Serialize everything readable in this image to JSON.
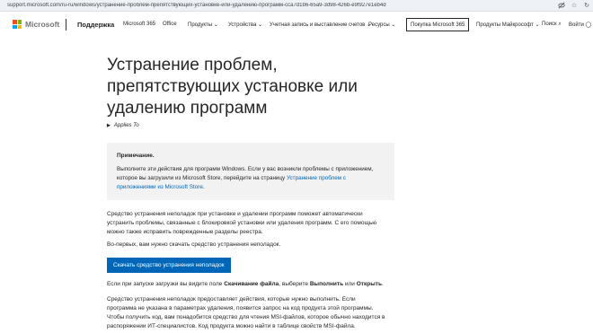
{
  "browser": {
    "url": "support.microsoft.com/ru-ru/windows/устранение-проблем-препятствующих-установке-или-удалению-программ-cca7d1b6-65a9-3d98-426b-e9f927e1eb4d"
  },
  "header": {
    "brand": "Microsoft",
    "section": "Поддержка",
    "nav": [
      "Microsoft 365",
      "Office",
      "Продукты",
      "Устройства",
      "Учетная запись и выставление счетов",
      "Ресурсы"
    ],
    "buy_button": "Покупка Microsoft 365",
    "right": [
      "Продукты Майкрософт",
      "Поиск",
      "Войти"
    ]
  },
  "article": {
    "title": "Устранение проблем, препятствующих установке или удалению программ",
    "applies_to": "Applies To",
    "note": {
      "heading": "Примечание.",
      "text": "Выполните эти действия для программ Windows. Если у вас возникли проблемы с приложением, которое вы загрузили из Microsoft Store, перейдите на страницу ",
      "link": "Устранение проблем с приложениями из Microsoft Store",
      "text_end": "."
    },
    "p1": "Средство устранения неполадок при установке и удалении программ поможет автоматически устранить проблемы, связанные с блокировкой установки или удаления программ. С его помощью можно также исправить поврежденные разделы реестра.",
    "p2": "Во-первых, вам нужно скачать средство устранения неполадок.",
    "download_button": "Скачать средство устранения неполадок",
    "p3_a": "Если при запуске загрузки вы видите поле ",
    "p3_b": "Скачивание файла",
    "p3_c": ", выберите ",
    "p3_d": "Выполнить",
    "p3_e": " или ",
    "p3_f": "Открыть",
    "p3_g": ".",
    "p4": "Средство устранения неполадок предоставляет действия, которые нужно выполнить. Если программа не указана в параметрах удаления, появится запрос на код продукта этой программы. Чтобы получить код, вам понадобится средство для чтения MSI-файлов, которое обычно находится в распоряжении ИТ-специалистов. Код продукта можно найти в таблице свойств MSI-файла."
  },
  "colors": {
    "accent": "#0067b8",
    "logo": [
      "#f25022",
      "#7fba00",
      "#00a4ef",
      "#ffb900"
    ]
  },
  "icons": [
    "eye-off-icon",
    "star-icon",
    "refresh-icon",
    "search-icon",
    "user-icon",
    "chevron-down-icon"
  ]
}
